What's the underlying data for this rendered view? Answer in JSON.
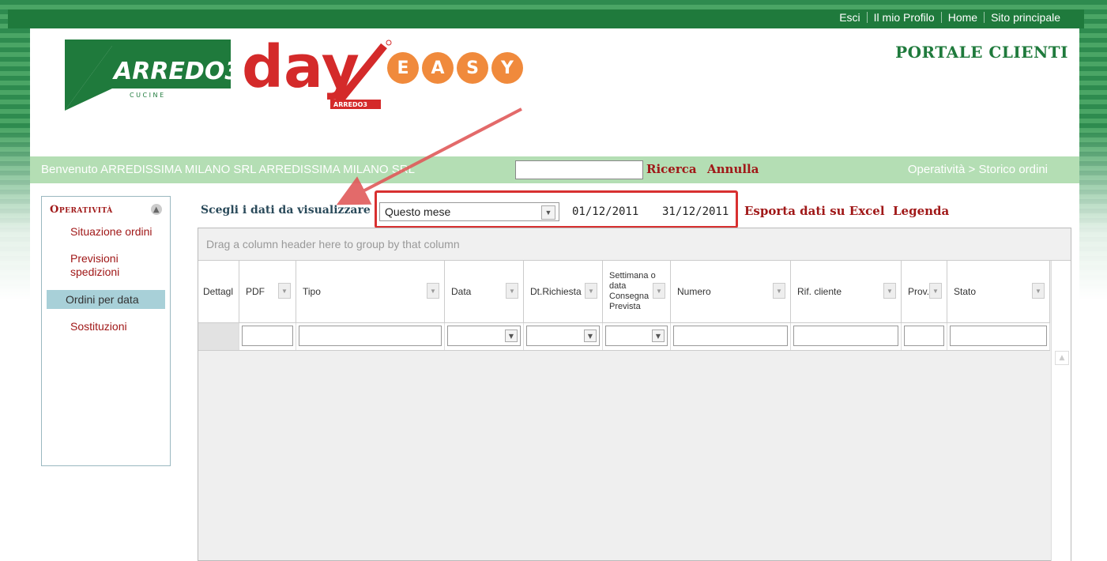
{
  "top_nav": {
    "links": [
      "Esci",
      "Il mio Profilo",
      "Home",
      "Sito principale"
    ]
  },
  "branding": {
    "arredo_logo": "ARREDO3",
    "arredo_sub": "C U C I N E",
    "day_logo": "day",
    "day_sub": "ARREDO3",
    "easy_letters": [
      "E",
      "A",
      "S",
      "Y"
    ],
    "portal_title": "PORTALE CLIENTI"
  },
  "welcome_bar": {
    "welcome_text": "Benvenuto ARREDISSIMA MILANO SRL ARREDISSIMA MILANO SRL",
    "search_value": "",
    "search_button": "Ricerca",
    "cancel_button": "Annulla",
    "breadcrumb": "Operatività > Storico ordini"
  },
  "sidebar": {
    "title": "Operatività",
    "items": [
      {
        "label": "Situazione ordini",
        "active": false
      },
      {
        "label": "Previsioni spedizioni",
        "active": false
      },
      {
        "label": "Ordini per data",
        "active": true
      },
      {
        "label": "Sostituzioni",
        "active": false
      }
    ]
  },
  "filter_bar": {
    "choose_label": "Scegli i dati da visualizzare",
    "period_value": "Questo mese",
    "date_from": "01/12/2011",
    "date_to": "31/12/2011",
    "export_link": "Esporta dati su Excel",
    "legend_link": "Legenda"
  },
  "grid": {
    "group_panel_hint": "Drag a column header here to group by that column",
    "columns": [
      "Dettagl",
      "PDF",
      "Tipo",
      "Data",
      "Dt.Richiesta",
      "Settimana o data Consegna Prevista",
      "Numero",
      "Rif. cliente",
      "Prov.",
      "Stato"
    ],
    "rows": []
  },
  "colors": {
    "brand_green": "#1f7a3c",
    "accent_red": "#a01818",
    "welcome_bar": "#b4deb4",
    "easy_orange": "#f08a3c",
    "highlight_box": "#d83030"
  }
}
